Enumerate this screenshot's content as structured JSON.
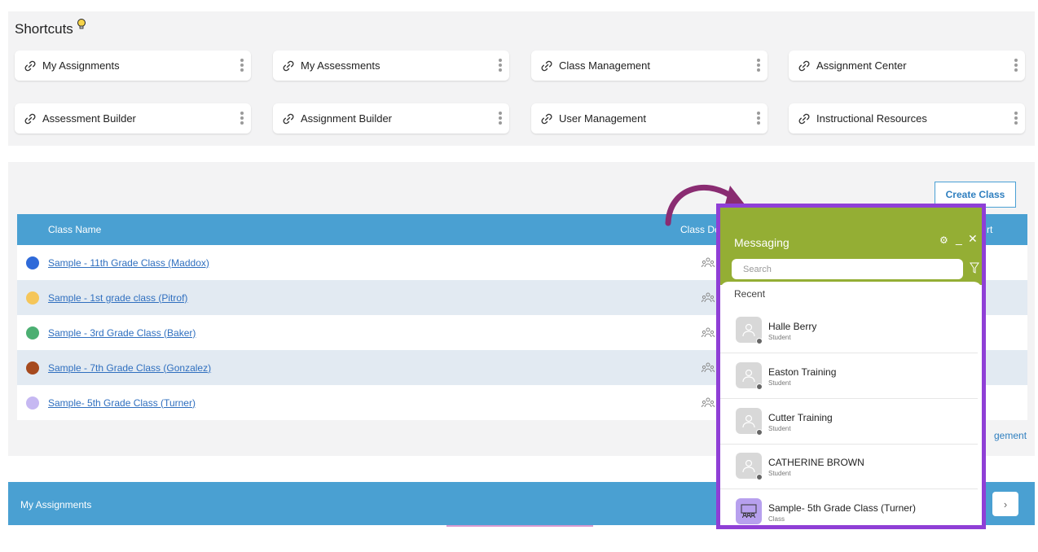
{
  "shortcuts": {
    "title": "Shortcuts",
    "items": [
      {
        "label": "My Assignments"
      },
      {
        "label": "My Assessments"
      },
      {
        "label": "Class Management"
      },
      {
        "label": "Assignment Center"
      },
      {
        "label": "Assessment Builder"
      },
      {
        "label": "Assignment Builder"
      },
      {
        "label": "User Management"
      },
      {
        "label": "Instructional Resources"
      }
    ]
  },
  "classes": {
    "create_button": "Create Class",
    "columns": {
      "name": "Class Name",
      "details": "Class De",
      "last": "rt"
    },
    "rows": [
      {
        "name": "Sample - 11th Grade Class (Maddox)",
        "color": "#2f6ad9"
      },
      {
        "name": "Sample - 1st grade class (Pitrof)",
        "color": "#f5c65a"
      },
      {
        "name": "Sample - 3rd Grade Class (Baker)",
        "color": "#4caf72"
      },
      {
        "name": "Sample - 7th Grade Class (Gonzalez)",
        "color": "#a64a1e"
      },
      {
        "name": "Sample- 5th Grade Class (Turner)",
        "color": "#c6b8f2"
      }
    ],
    "management_link": "gement"
  },
  "assignments_bar": {
    "title": "My Assignments",
    "next": "›"
  },
  "messaging": {
    "title": "Messaging",
    "gear": "⚙",
    "minimize": "_",
    "close": "✕",
    "search_placeholder": "Search",
    "recent_label": "Recent",
    "contacts": [
      {
        "name": "Halle Berry",
        "role": "Student"
      },
      {
        "name": "Easton Training",
        "role": "Student"
      },
      {
        "name": "Cutter Training",
        "role": "Student"
      },
      {
        "name": "CATHERINE BROWN",
        "role": "Student"
      },
      {
        "name": "Sample- 5th Grade Class (Turner)",
        "role": "Class"
      }
    ]
  },
  "colors": {
    "header_blue": "#4aa0d2",
    "messaging_green": "#94ae34",
    "highlight_purple": "#8f3fd6",
    "arrow": "#8a2c72"
  }
}
